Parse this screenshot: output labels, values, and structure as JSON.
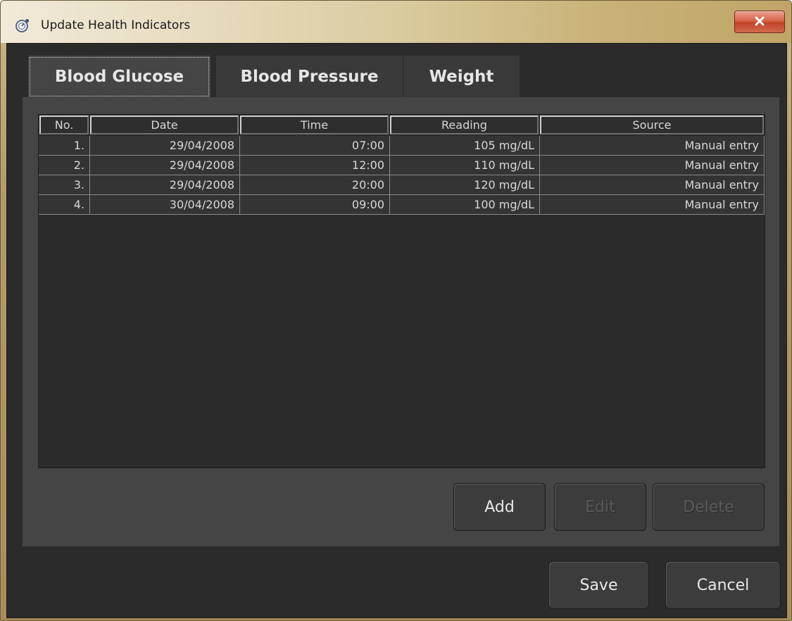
{
  "window": {
    "title": "Update Health Indicators",
    "icon": "health-indicator-icon",
    "close_icon": "close-x-icon"
  },
  "tabs": [
    {
      "label": "Blood Glucose",
      "active": true
    },
    {
      "label": "Blood Pressure",
      "active": false
    },
    {
      "label": "Weight",
      "active": false
    }
  ],
  "table": {
    "columns": [
      "No.",
      "Date",
      "Time",
      "Reading",
      "Source"
    ],
    "rows": [
      {
        "no": "1.",
        "date": "29/04/2008",
        "time": "07:00",
        "reading": "105 mg/dL",
        "source": "Manual entry"
      },
      {
        "no": "2.",
        "date": "29/04/2008",
        "time": "12:00",
        "reading": "110 mg/dL",
        "source": "Manual entry"
      },
      {
        "no": "3.",
        "date": "29/04/2008",
        "time": "20:00",
        "reading": "120 mg/dL",
        "source": "Manual entry"
      },
      {
        "no": "4.",
        "date": "30/04/2008",
        "time": "09:00",
        "reading": "100 mg/dL",
        "source": "Manual entry"
      }
    ]
  },
  "panel_buttons": {
    "add": "Add",
    "edit": "Edit",
    "delete": "Delete"
  },
  "dialog_buttons": {
    "save": "Save",
    "cancel": "Cancel"
  },
  "colors": {
    "window_background": "#2b2b2b",
    "panel_background": "#454545",
    "close_button": "#c3432a"
  }
}
